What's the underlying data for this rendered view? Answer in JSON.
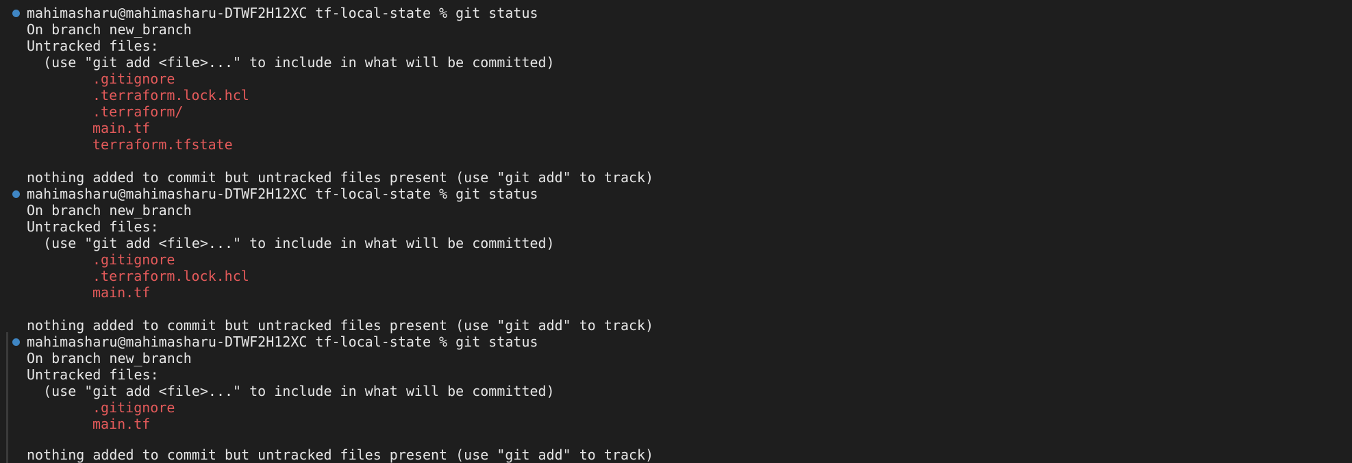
{
  "blocks": [
    {
      "prompt": "mahimasharu@mahimasharu-DTWF2H12XC tf-local-state % git status",
      "branch_line": "On branch new_branch",
      "untracked_header": "Untracked files:",
      "hint": "  (use \"git add <file>...\" to include in what will be committed)",
      "files": [
        ".gitignore",
        ".terraform.lock.hcl",
        ".terraform/",
        "main.tf",
        "terraform.tfstate"
      ],
      "summary": "nothing added to commit but untracked files present (use \"git add\" to track)"
    },
    {
      "prompt": "mahimasharu@mahimasharu-DTWF2H12XC tf-local-state % git status",
      "branch_line": "On branch new_branch",
      "untracked_header": "Untracked files:",
      "hint": "  (use \"git add <file>...\" to include in what will be committed)",
      "files": [
        ".gitignore",
        ".terraform.lock.hcl",
        "main.tf"
      ],
      "summary": "nothing added to commit but untracked files present (use \"git add\" to track)"
    },
    {
      "prompt": "mahimasharu@mahimasharu-DTWF2H12XC tf-local-state % git status",
      "branch_line": "On branch new_branch",
      "untracked_header": "Untracked files:",
      "hint": "  (use \"git add <file>...\" to include in what will be committed)",
      "files": [
        ".gitignore",
        "main.tf"
      ],
      "summary": "nothing added to commit but untracked files present (use \"git add\" to track)"
    }
  ],
  "colors": {
    "background": "#1e1e1e",
    "text": "#e6e6e6",
    "untracked_file": "#e35a5a",
    "prompt_marker": "#3f86c4"
  },
  "icons": {
    "prompt_marker": "command-status-dot-icon"
  }
}
